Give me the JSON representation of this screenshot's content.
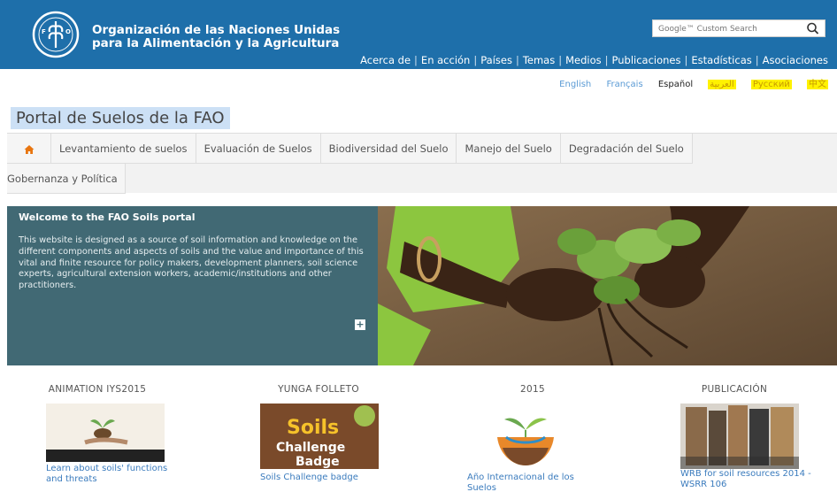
{
  "header": {
    "org_line1": "Organización de las Naciones Unidas",
    "org_line2": "para la Alimentación y la Agricultura",
    "search_placeholder": "Google™ Custom Search",
    "brand_color": "#1e6faa",
    "nav": [
      "Acerca de",
      "En acción",
      "Países",
      "Temas",
      "Medios",
      "Publicaciones",
      "Estadísticas",
      "Asociaciones"
    ]
  },
  "languages": [
    {
      "label": "English",
      "state": "link"
    },
    {
      "label": "Français",
      "state": "link"
    },
    {
      "label": "Español",
      "state": "active"
    },
    {
      "label": "العربية",
      "state": "highlighted"
    },
    {
      "label": "Русский",
      "state": "highlighted"
    },
    {
      "label": "中文",
      "state": "highlighted"
    }
  ],
  "portal_title": "Portal de Suelos de la FAO",
  "menu": {
    "home_icon": "home-icon",
    "items_row1": [
      "Levantamiento de suelos",
      "Evaluación de Suelos",
      "Biodiversidad del Suelo",
      "Manejo del Suelo",
      "Degradación del Suelo"
    ],
    "items_row2": [
      "Gobernanza y Política"
    ]
  },
  "hero": {
    "title": "Welcome to the FAO Soils portal",
    "body": "This website is designed as a source of soil information and knowledge on the different components and aspects of soils and the value and importance of this vital and finite resource for policy makers, development planners, soil science experts, agricultural extension workers, academic/institutions and other practitioners.",
    "panel_color": "#416974",
    "expand_icon": "plus-icon"
  },
  "features": [
    {
      "heading": "ANIMATION IYS2015",
      "caption": "Learn about soils' functions and threats"
    },
    {
      "heading": "YUNGA FOLLETO",
      "caption": "Soils Challenge badge",
      "thumb_text": [
        "Soils",
        "Challenge",
        "Badge"
      ]
    },
    {
      "heading": "2015",
      "caption": "Año Internacional de los Suelos"
    },
    {
      "heading": "PUBLICACIÓN",
      "caption": "WRB for soil resources 2014 - WSRR 106"
    }
  ]
}
